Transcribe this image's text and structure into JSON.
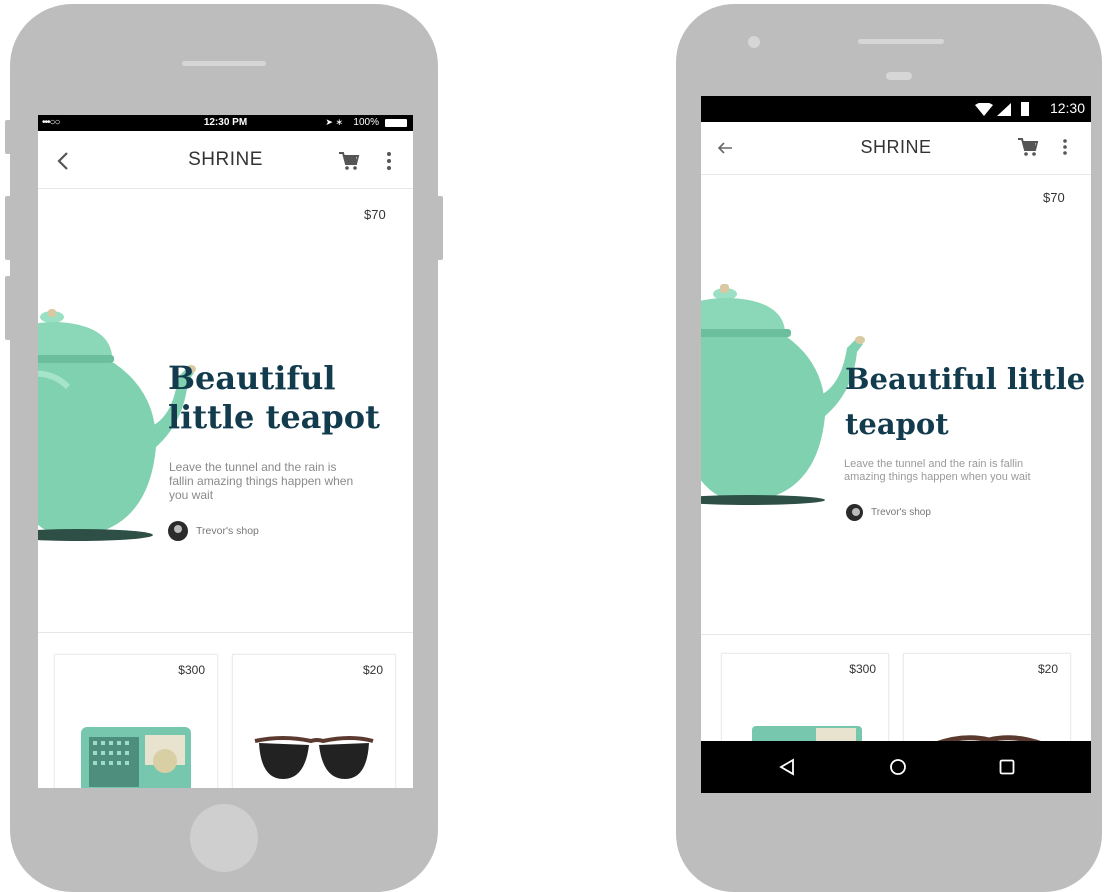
{
  "ios": {
    "status": {
      "carrier": "•••○○",
      "time": "12:30 PM",
      "battery": "100%"
    },
    "appbar": {
      "title": "SHRINE"
    },
    "hero": {
      "price": "$70",
      "title_line1": "Beautiful",
      "title_line2": "little teapot",
      "desc_line1": "Leave the tunnel and the rain is",
      "desc_line2": "fallin amazing things happen when",
      "desc_line3": "you wait",
      "shop": "Trevor's shop"
    },
    "cards": [
      {
        "price": "$300"
      },
      {
        "price": "$20"
      }
    ]
  },
  "android": {
    "status": {
      "time": "12:30"
    },
    "appbar": {
      "title": "SHRINE"
    },
    "hero": {
      "price": "$70",
      "title_line1": "Beautiful little",
      "title_line2": "teapot",
      "desc_line1": "Leave the tunnel and the rain is fallin",
      "desc_line2": "amazing things happen when you wait",
      "shop": "Trevor's shop"
    },
    "cards": [
      {
        "price": "$300"
      },
      {
        "price": "$20"
      }
    ]
  },
  "colors": {
    "phone_body": "#bdbdbd",
    "headline": "#123b4d",
    "teapot": "#7fd1b0"
  },
  "icons": [
    "back-chevron-icon",
    "back-arrow-icon",
    "cart-icon",
    "more-vert-icon",
    "wifi-icon",
    "signal-icon",
    "battery-icon",
    "nav-back-icon",
    "nav-home-icon",
    "nav-recents-icon"
  ]
}
